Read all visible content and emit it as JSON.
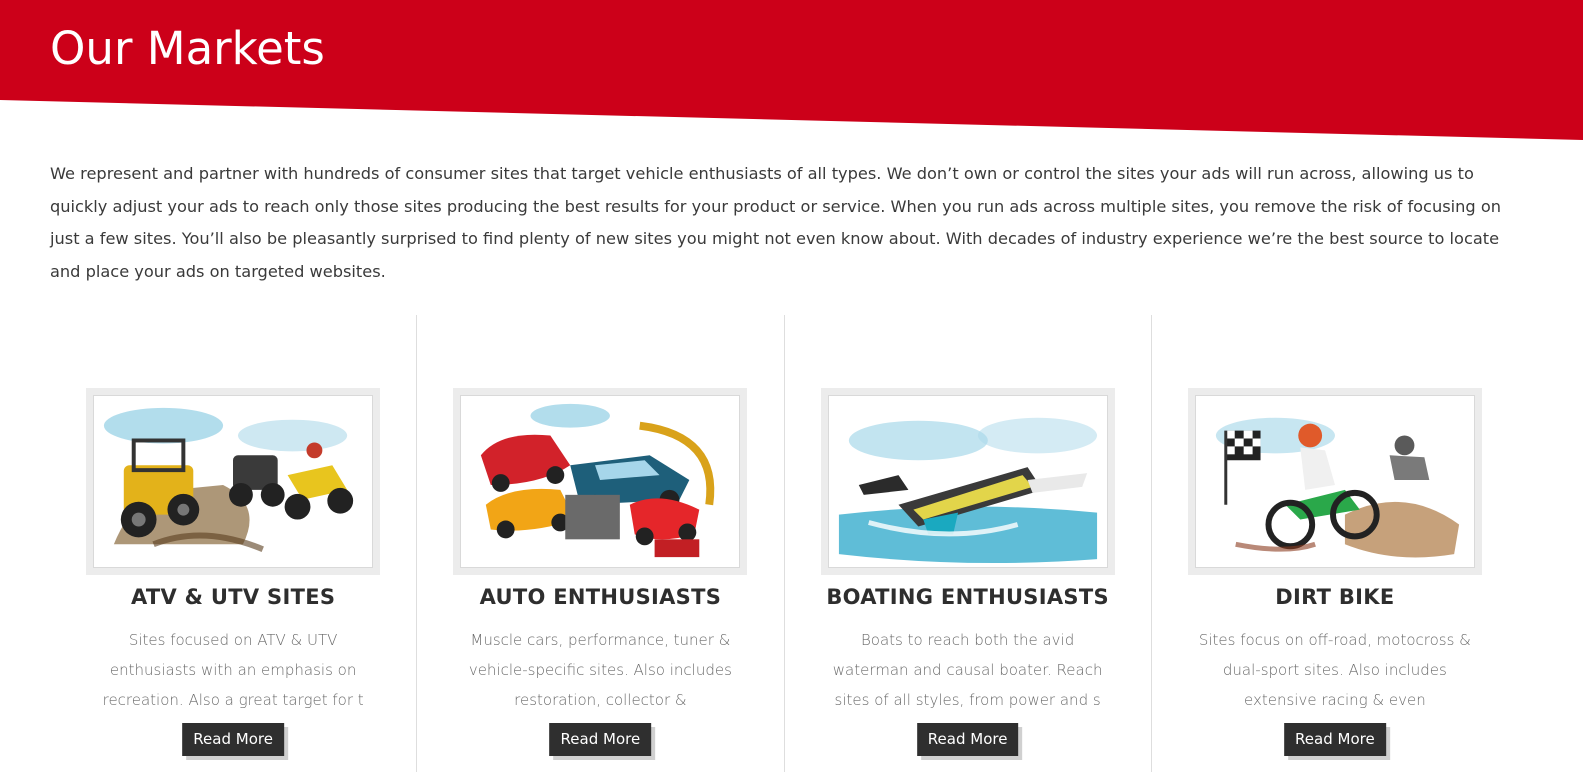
{
  "header": {
    "title": "Our Markets",
    "color": "#cc0019"
  },
  "intro": {
    "text": "We represent and partner with hundreds of consumer sites that target vehicle enthusiasts of all types. We don’t own or control the sites your ads will run across, allowing us to quickly adjust your ads to reach only those sites producing the best results for your product or service. When you run ads across multiple sites, you remove the risk of focusing on just a few sites. You’ll also be pleasantly surprised to find plenty of new sites you might not even know about. With decades of industry experience we’re the best source to locate and place your ads on targeted websites."
  },
  "markets": [
    {
      "title": "ATV & UTV SITES",
      "description": "Sites focused on ATV & UTV enthusiasts with an emphasis on recreation. Also a great target for t",
      "button": "Read More",
      "image": "atv-utv-illustration"
    },
    {
      "title": "AUTO ENTHUSIASTS",
      "description": "Muscle cars, performance, tuner & vehicle-specific sites. Also includes restoration, collector &",
      "button": "Read More",
      "image": "auto-enthusiasts-illustration"
    },
    {
      "title": "BOATING ENTHUSIASTS",
      "description": "Boats to reach both the avid waterman and causal boater. Reach sites of all styles, from power and s",
      "button": "Read More",
      "image": "boating-illustration"
    },
    {
      "title": "DIRT BIKE",
      "description": "Sites focus on off-road, motocross & dual-sport sites. Also includes extensive racing & even",
      "button": "Read More",
      "image": "dirt-bike-illustration"
    }
  ]
}
